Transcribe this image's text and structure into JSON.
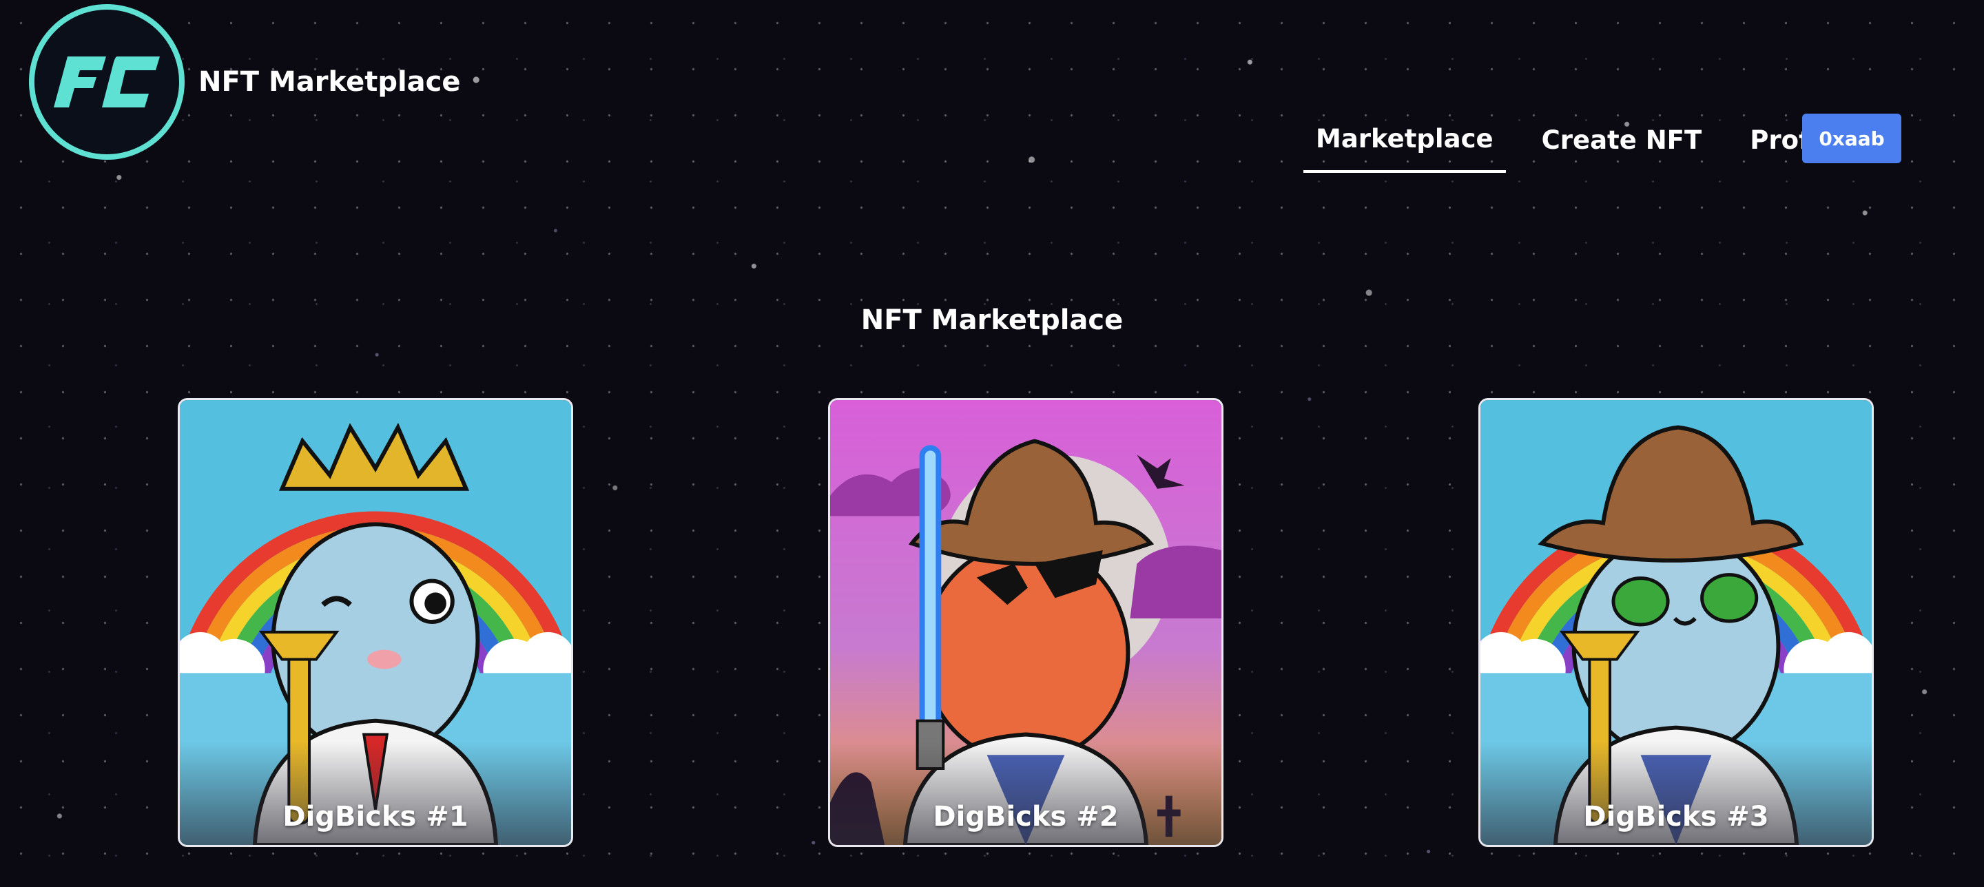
{
  "header": {
    "logo_text": "FC",
    "brand": "NFT Marketplace",
    "nav": [
      {
        "label": "Marketplace",
        "active": true
      },
      {
        "label": "Create NFT",
        "active": false
      },
      {
        "label": "Profile",
        "active": false
      }
    ],
    "wallet_label": "0xaab"
  },
  "main": {
    "title": "NFT Marketplace",
    "nfts": [
      {
        "name": "DigBicks #1",
        "background": "rainbow",
        "hat": "crown",
        "eyes": "wink",
        "face_color": "#a7cfe3",
        "accessory": "trumpet"
      },
      {
        "name": "DigBicks #2",
        "background": "halloween",
        "hat": "cowboy",
        "eyes": "sunglasses",
        "face_color": "#ea6a3e",
        "accessory": "lightsaber"
      },
      {
        "name": "DigBicks #3",
        "background": "rainbow",
        "hat": "cowboy",
        "eyes": "alien",
        "face_color": "#a7cfe3",
        "accessory": "trumpet"
      }
    ]
  },
  "colors": {
    "accent": "#5ee0d2",
    "wallet_button": "#4b7ff0",
    "background": "#0b0912"
  }
}
